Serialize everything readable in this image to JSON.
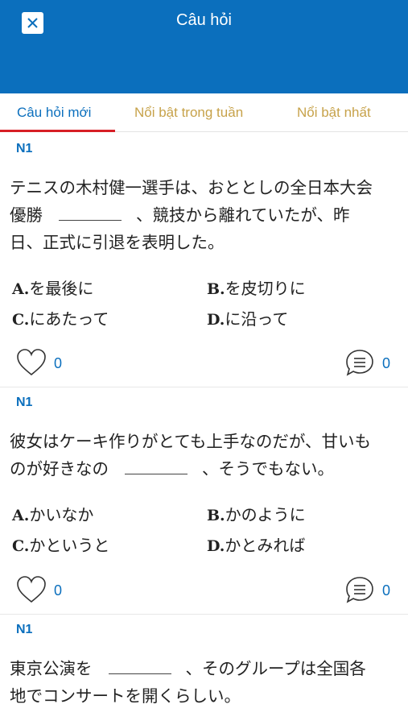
{
  "header": {
    "title": "Câu hỏi",
    "close_icon": "close-icon"
  },
  "tabs": [
    {
      "label": "Câu hỏi mới",
      "active": true
    },
    {
      "label": "Nổi bật trong tuần",
      "active": false
    },
    {
      "label": "Nổi bật nhất",
      "active": false
    }
  ],
  "colors": {
    "primary": "#0b6fbd",
    "tab_inactive": "#c7a24a",
    "indicator": "#d71f26"
  },
  "questions": [
    {
      "level": "N1",
      "text_line1": "テニスの木村健一選手は、おととしの全日本大会",
      "text_line2_before": "優勝",
      "text_line2_after": "、競技から離れていたが、昨",
      "text_line3": "日、正式に引退を表明した。",
      "options": [
        {
          "letter": "A.",
          "text": "を最後に"
        },
        {
          "letter": "B.",
          "text": "を皮切りに"
        },
        {
          "letter": "C.",
          "text": "にあたって"
        },
        {
          "letter": "D.",
          "text": "に沿って"
        }
      ],
      "likes": "0",
      "comments": "0"
    },
    {
      "level": "N1",
      "text_line1": "彼女はケーキ作りがとても上手なのだが、甘いも",
      "text_line2_before": "のが好きなの",
      "text_line2_after": "、そうでもない。",
      "options": [
        {
          "letter": "A.",
          "text": "かいなか"
        },
        {
          "letter": "B.",
          "text": "かのように"
        },
        {
          "letter": "C.",
          "text": "かというと"
        },
        {
          "letter": "D.",
          "text": "かとみれば"
        }
      ],
      "likes": "0",
      "comments": "0"
    },
    {
      "level": "N1",
      "text_line1_before": "東京公演を",
      "text_line1_after": "、そのグループは全国各",
      "text_line2": "地でコンサートを開くらしい。"
    }
  ]
}
